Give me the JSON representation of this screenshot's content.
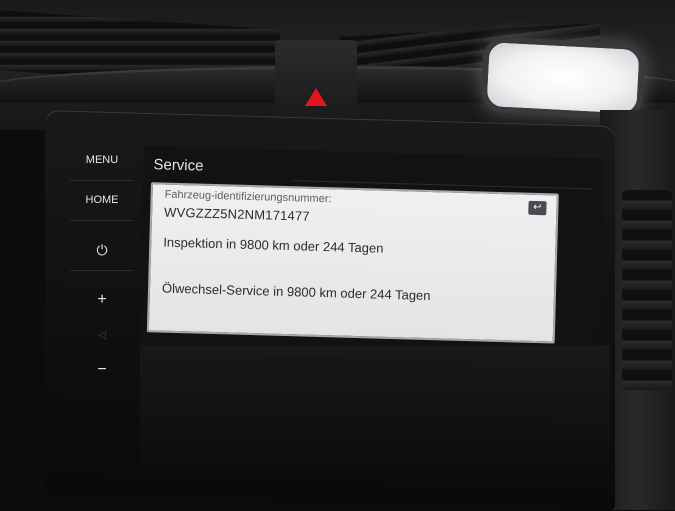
{
  "hardware_buttons": {
    "menu": "MENU",
    "home": "HOME",
    "power_symbol": "⏻",
    "volume_up": "+",
    "mute_symbol": "◁",
    "volume_down": "−"
  },
  "screen": {
    "title": "Service",
    "back_symbol": "↩",
    "vin_label": "Fahrzeug-identifizierungsnummer:",
    "vin_value": "WVGZZZ5N2NM171477",
    "inspection": "Inspektion in 9800 km oder 244 Tagen",
    "oil_service": "Ölwechsel-Service in 9800 km oder 244 Tagen"
  },
  "colors": {
    "hazard": "#e1141f",
    "card_background": "#f1eff0",
    "screen_background": "#121214"
  },
  "icons": {
    "hazard": "hazard-warning-icon",
    "power": "power-icon",
    "back": "back-icon"
  }
}
